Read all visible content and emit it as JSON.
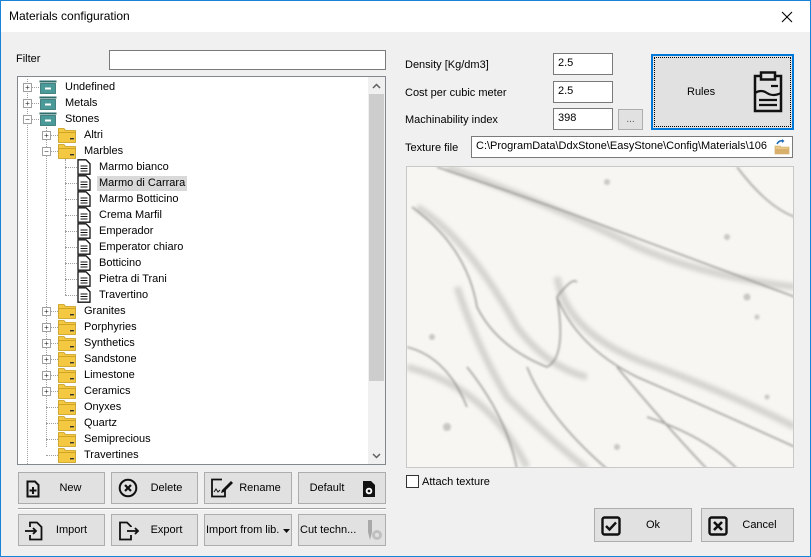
{
  "window": {
    "title": "Materials configuration",
    "close_icon": "close-icon"
  },
  "filter": {
    "label": "Filter",
    "value": "",
    "placeholder": ""
  },
  "tree": {
    "nodes": [
      {
        "label": "Undefined",
        "level": 0,
        "icon": "category-icon",
        "expander": "+"
      },
      {
        "label": "Metals",
        "level": 0,
        "icon": "category-icon",
        "expander": "+"
      },
      {
        "label": "Stones",
        "level": 0,
        "icon": "category-icon",
        "expander": "-"
      },
      {
        "label": "Altri",
        "level": 1,
        "icon": "folder-icon",
        "expander": "+"
      },
      {
        "label": "Marbles",
        "level": 1,
        "icon": "folder-icon",
        "expander": "-"
      },
      {
        "label": "Marmo bianco",
        "level": 2,
        "icon": "document-icon",
        "expander": ""
      },
      {
        "label": "Marmo di Carrara",
        "level": 2,
        "icon": "document-icon",
        "expander": "",
        "selected": true
      },
      {
        "label": "Marmo Botticino",
        "level": 2,
        "icon": "document-icon",
        "expander": ""
      },
      {
        "label": "Crema Marfil",
        "level": 2,
        "icon": "document-icon",
        "expander": ""
      },
      {
        "label": "Emperador",
        "level": 2,
        "icon": "document-icon",
        "expander": ""
      },
      {
        "label": "Emperator chiaro",
        "level": 2,
        "icon": "document-icon",
        "expander": ""
      },
      {
        "label": "Botticino",
        "level": 2,
        "icon": "document-icon",
        "expander": ""
      },
      {
        "label": "Pietra di Trani",
        "level": 2,
        "icon": "document-icon",
        "expander": ""
      },
      {
        "label": "Travertino",
        "level": 2,
        "icon": "document-icon",
        "expander": ""
      },
      {
        "label": "Granites",
        "level": 1,
        "icon": "folder-icon",
        "expander": "+"
      },
      {
        "label": "Porphyries",
        "level": 1,
        "icon": "folder-icon",
        "expander": "+"
      },
      {
        "label": "Synthetics",
        "level": 1,
        "icon": "folder-icon",
        "expander": "+"
      },
      {
        "label": "Sandstone",
        "level": 1,
        "icon": "folder-icon",
        "expander": "+"
      },
      {
        "label": "Limestone",
        "level": 1,
        "icon": "folder-icon",
        "expander": "+"
      },
      {
        "label": "Ceramics",
        "level": 1,
        "icon": "folder-icon",
        "expander": "+"
      },
      {
        "label": "Onyxes",
        "level": 1,
        "icon": "folder-icon",
        "expander": ""
      },
      {
        "label": "Quartz",
        "level": 1,
        "icon": "folder-icon",
        "expander": ""
      },
      {
        "label": "Semiprecious",
        "level": 1,
        "icon": "folder-icon",
        "expander": ""
      },
      {
        "label": "Travertines",
        "level": 1,
        "icon": "folder-icon",
        "expander": ""
      }
    ]
  },
  "properties": {
    "density_label": "Density [Kg/dm3]",
    "density_value": "2.5",
    "cost_label": "Cost per cubic meter",
    "cost_value": "2.5",
    "machinability_label": "Machinability index",
    "machinability_value": "398",
    "machinability_browse": "...",
    "texture_label": "Texture file",
    "texture_value": "C:\\ProgramData\\DdxStone\\EasyStone\\Config\\Materials\\106"
  },
  "rules_button": {
    "label": "Rules",
    "icon": "clipboard-icon"
  },
  "attach_texture": {
    "label": "Attach texture",
    "checked": false
  },
  "buttons": {
    "new": "New",
    "delete": "Delete",
    "rename": "Rename",
    "default": "Default",
    "import": "Import",
    "export": "Export",
    "import_from_lib": "Import from lib.",
    "cut_techn": "Cut techn...",
    "ok": "Ok",
    "cancel": "Cancel"
  },
  "colors": {
    "accent": "#1883d7",
    "folder": "#f5c842",
    "category": "#3d8a8a",
    "button_face": "#e1e1e1"
  }
}
